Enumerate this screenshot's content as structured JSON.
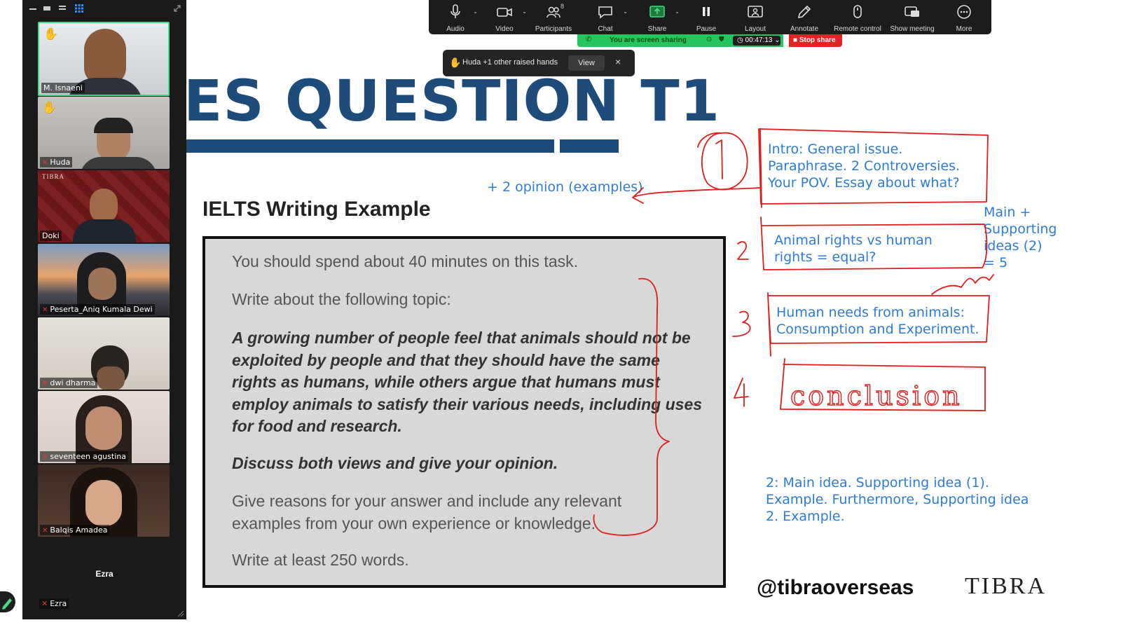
{
  "participants": [
    {
      "name": "M. Isnaeni",
      "hand_raised": true,
      "muted": false,
      "active": true
    },
    {
      "name": "Huda",
      "hand_raised": true,
      "muted": true
    },
    {
      "name": "Doki",
      "muted": false
    },
    {
      "name": "Peserta_Aniq Kumala Dewi",
      "muted": true
    },
    {
      "name": "dwi dharma",
      "muted": true
    },
    {
      "name": "seventeen agustina",
      "muted": true
    },
    {
      "name": "Balqis Amadea",
      "muted": true
    }
  ],
  "ezra": {
    "display_name": "Ezra",
    "label": "Ezra"
  },
  "toolbar": {
    "buttons": [
      {
        "label": "Audio",
        "icon": "microphone-icon"
      },
      {
        "label": "Video",
        "icon": "video-camera-icon"
      },
      {
        "label": "Participants",
        "icon": "participants-icon",
        "count": "8"
      },
      {
        "label": "Chat",
        "icon": "chat-icon"
      },
      {
        "label": "Share",
        "icon": "share-screen-icon"
      },
      {
        "label": "Pause",
        "icon": "pause-icon"
      },
      {
        "label": "Layout",
        "icon": "layout-icon"
      },
      {
        "label": "Annotate",
        "icon": "pencil-icon"
      },
      {
        "label": "Remote control",
        "icon": "mouse-icon"
      },
      {
        "label": "Show meeting",
        "icon": "show-meeting-icon"
      },
      {
        "label": "More",
        "icon": "more-icon"
      }
    ]
  },
  "share_bar": {
    "status": "You are screen sharing",
    "timer": "00:47:13",
    "stop": "Stop share"
  },
  "raise_notice": {
    "text": "Huda +1 other raised hands",
    "view": "View",
    "close": "×"
  },
  "slide": {
    "title": "ES QUESTION T1",
    "heading": "IELTS Writing Example",
    "line1": "You should spend about 40 minutes on this task.",
    "line2": "Write about the following topic:",
    "topic": "A growing number of people feel that animals should not be exploited by people and that they should have the same rights as humans, while others argue that humans must employ animals to satisfy their various needs, including uses for food and research.",
    "instruction": "Discuss both views and give your opinion.",
    "reasons": "Give reasons for your answer and include any relevant examples from your own experience or knowledge.",
    "word_count": "Write at least 250 words.",
    "handle": "@tibraoverseas",
    "logo": "TIBRA"
  },
  "annotations": {
    "opinion": "+ 2 opinion (examples)",
    "intro": [
      "Intro: General issue.",
      "Paraphrase. 2 Controversies.",
      "Your POV. Essay about what?"
    ],
    "body1": [
      "Animal rights vs human",
      "rights = equal?"
    ],
    "main_support": [
      "Main +",
      "Supporting",
      "ideas (2)",
      "= 5"
    ],
    "body2": [
      "Human needs from animals:",
      "Consumption and Experiment."
    ],
    "conclusion": "conclusion",
    "note2": [
      "2: Main idea. Supporting idea (1).",
      "Example. Furthermore, Supporting idea",
      "2. Example."
    ],
    "numbers": [
      "1",
      "2",
      "3",
      "4"
    ],
    "colors": {
      "ink_red": "#e31b1b",
      "ink_blue": "#2e7bd6",
      "title_blue": "#1d4b7a"
    }
  }
}
